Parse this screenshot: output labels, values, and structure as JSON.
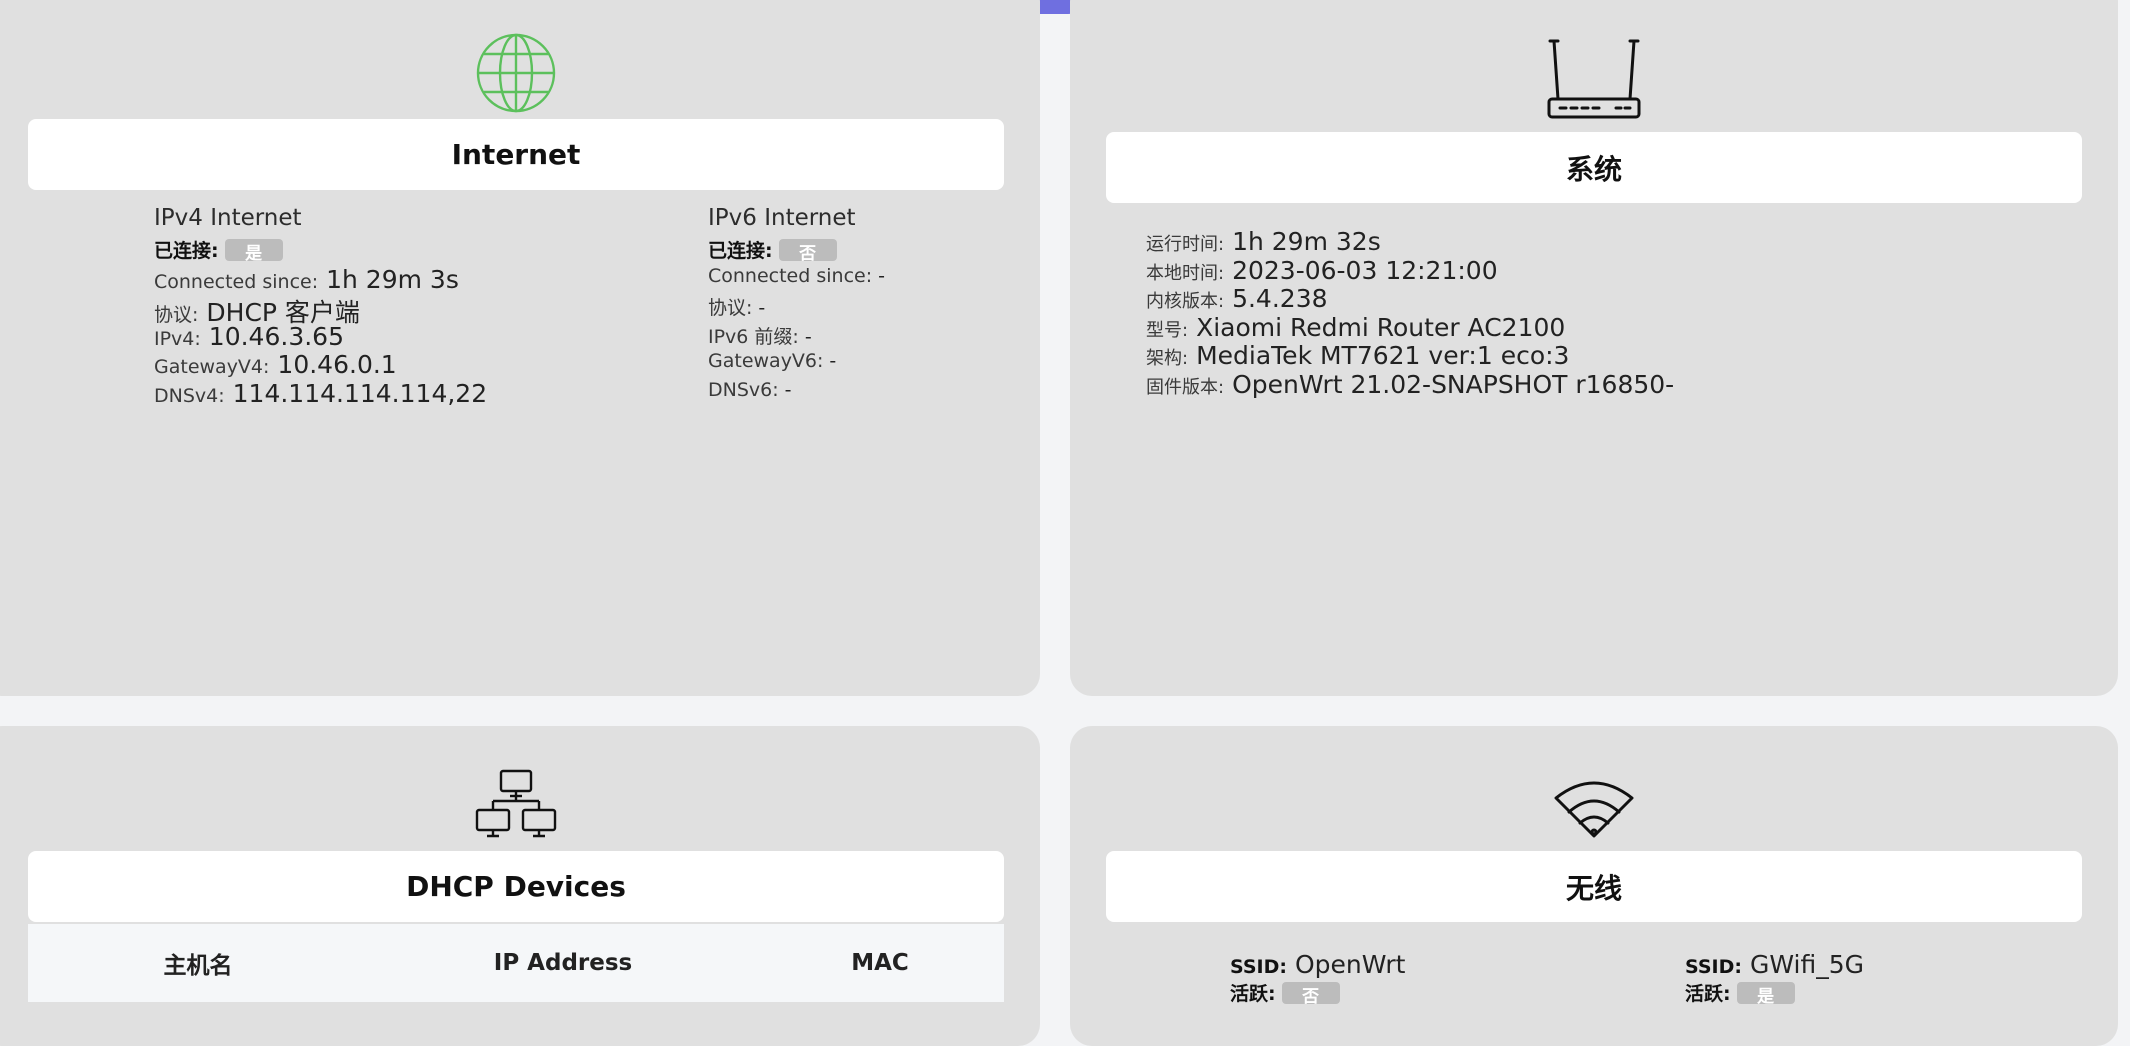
{
  "internet": {
    "title": "Internet",
    "ipv4": {
      "heading": "IPv4 Internet",
      "connected_label": "已连接:",
      "connected_badge": "是",
      "since_label": "Connected since:",
      "since_value": "1h 29m 3s",
      "protocol_label": "协议:",
      "protocol_value": "DHCP 客户端",
      "addr_label": "IPv4:",
      "addr_value": "10.46.3.65",
      "gateway_label": "GatewayV4:",
      "gateway_value": "10.46.0.1",
      "dns_label": "DNSv4:",
      "dns_value": "114.114.114.114,22"
    },
    "ipv6": {
      "heading": "IPv6 Internet",
      "connected_label": "已连接:",
      "connected_badge": "否",
      "since_label": "Connected since:",
      "since_value": "-",
      "protocol_label": "协议:",
      "protocol_value": "-",
      "prefix_label": "IPv6 前缀:",
      "prefix_value": "-",
      "gateway_label": "GatewayV6:",
      "gateway_value": "-",
      "dns_label": "DNSv6:",
      "dns_value": "-"
    }
  },
  "system": {
    "title": "系统",
    "rows": [
      {
        "label": "运行时间:",
        "value": "1h 29m 32s"
      },
      {
        "label": "本地时间:",
        "value": "2023-06-03 12:21:00"
      },
      {
        "label": "内核版本:",
        "value": "5.4.238"
      },
      {
        "label": "型号:",
        "value": "Xiaomi Redmi Router AC2100"
      },
      {
        "label": "架构:",
        "value": "MediaTek MT7621 ver:1 eco:3"
      },
      {
        "label": "固件版本:",
        "value": "OpenWrt 21.02-SNAPSHOT r16850-"
      }
    ]
  },
  "dhcp": {
    "title": "DHCP Devices",
    "columns": [
      "主机名",
      "IP Address",
      "MAC"
    ]
  },
  "wireless": {
    "title": "无线",
    "radios": [
      {
        "ssid_label": "SSID:",
        "ssid": "OpenWrt",
        "active_label": "活跃:",
        "active_badge": "否"
      },
      {
        "ssid_label": "SSID:",
        "ssid": "GWifi_5G",
        "active_label": "活跃:",
        "active_badge": "是"
      }
    ]
  },
  "colors": {
    "globe": "#5cc05c",
    "card_bg": "#e0e0e0",
    "page_bg": "#f3f4f6",
    "accent": "#6f6fe0",
    "badge": "#bcbcbc"
  }
}
